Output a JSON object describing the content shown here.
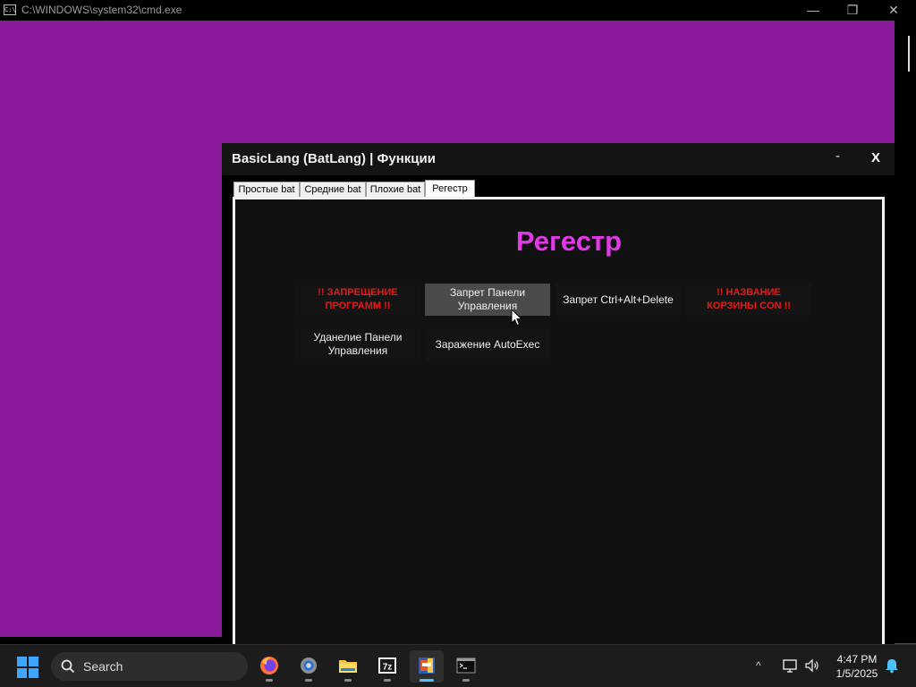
{
  "cmd_window": {
    "title": "C:\\WINDOWS\\system32\\cmd.exe",
    "icon_text": "C:\\",
    "controls": {
      "minimize": "—",
      "maximize": "❐",
      "close": "✕"
    }
  },
  "app_window": {
    "title": "BasicLang (BatLang) | Функции",
    "minimize_label": "-",
    "close_label": "X",
    "tabs": [
      {
        "label": "Простые bat",
        "active": false
      },
      {
        "label": "Средние bat",
        "active": false
      },
      {
        "label": "Плохие bat",
        "active": false
      },
      {
        "label": "Регестр",
        "active": true
      }
    ],
    "panel": {
      "heading": "Регестр",
      "heading_color": "#e03ae6",
      "buttons": [
        {
          "label": "!! ЗАПРЕЩЕНИЕ ПРОГРАММ !!",
          "style": "danger"
        },
        {
          "label": "Запрет Панели Управления",
          "style": "hover"
        },
        {
          "label": "Запрет Ctrl+Alt+Delete",
          "style": "normal"
        },
        {
          "label": "!! НАЗВАНИЕ КОРЗИНЫ CON !!",
          "style": "danger"
        },
        {
          "label": "Уданелие Панели Управления",
          "style": "normal"
        },
        {
          "label": "Заражение AutoExec",
          "style": "normal"
        }
      ]
    }
  },
  "taskbar": {
    "start_icon": "windows-logo-icon",
    "search_placeholder": "Search",
    "apps": [
      {
        "name": "firefox-icon",
        "active": false
      },
      {
        "name": "settings-icon",
        "active": false
      },
      {
        "name": "file-explorer-icon",
        "active": false
      },
      {
        "name": "7zip-icon",
        "active": false,
        "text": "7z"
      },
      {
        "name": "batlang-app-icon",
        "active": true
      },
      {
        "name": "terminal-icon",
        "active": false
      }
    ],
    "tray": {
      "chevron": "^",
      "time": "4:47 PM",
      "date": "1/5/2025"
    }
  },
  "colors": {
    "desktop_purple": "#8a1a9b",
    "danger_red": "#e21b1b",
    "accent_blue": "#4cc2ff"
  }
}
